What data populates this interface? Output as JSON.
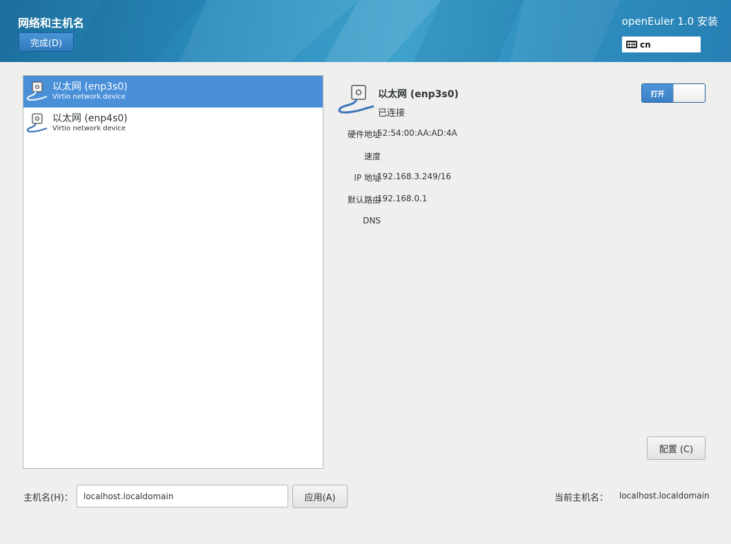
{
  "header": {
    "title": "网络和主机名",
    "done_label": "完成(D)",
    "product": "openEuler 1.0 安装",
    "keyboard_layout": "cn"
  },
  "devices": [
    {
      "name": "以太网 (enp3s0)",
      "description": "Virtio network device",
      "selected": true
    },
    {
      "name": "以太网 (enp4s0)",
      "description": "Virtio network device",
      "selected": false
    }
  ],
  "detail": {
    "title": "以太网 (enp3s0)",
    "status": "已连接",
    "rows": [
      {
        "label": "硬件地址",
        "value": "52:54:00:AA:AD:4A"
      },
      {
        "label": "速度",
        "value": ""
      },
      {
        "label": "IP 地址",
        "value": "192.168.3.249/16"
      },
      {
        "label": "默认路由",
        "value": "192.168.0.1"
      },
      {
        "label": "DNS",
        "value": ""
      }
    ],
    "toggle_label": "打开",
    "toggle_on": true,
    "config_label": "配置 (C)"
  },
  "hostname": {
    "label": "主机名(H)：",
    "value": "localhost.localdomain",
    "apply_label": "应用(A)",
    "current_label": "当前主机名：",
    "current_value": "localhost.localdomain"
  },
  "colors": {
    "accent": "#4a90d9",
    "header": "#2a8cbd"
  }
}
